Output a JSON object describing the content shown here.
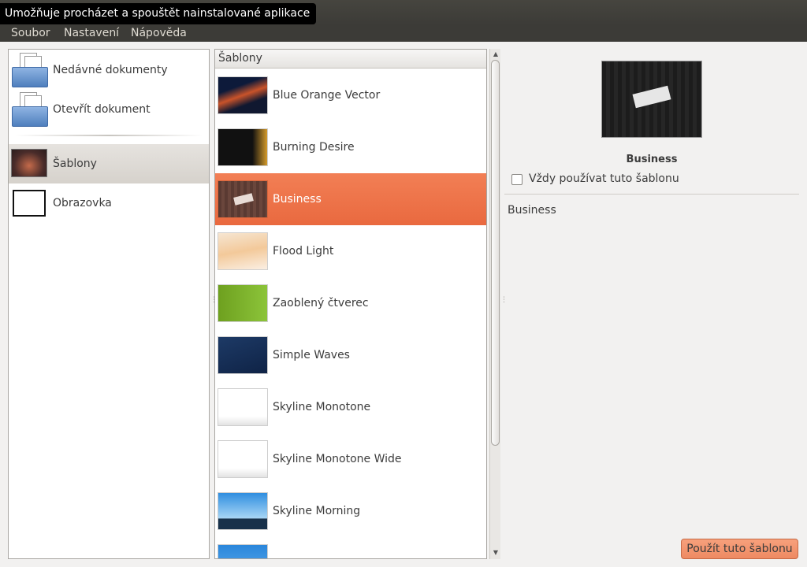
{
  "window": {
    "tooltip": "Umožňuje procházet a spouštět nainstalované aplikace"
  },
  "menubar": {
    "items": [
      "Soubor",
      "Nastavení",
      "Nápověda"
    ]
  },
  "sidebar": {
    "items": [
      {
        "label": "Nedávné dokumenty",
        "icon": "folder-documents-icon"
      },
      {
        "label": "Otevřít dokument",
        "icon": "folder-documents-icon"
      },
      {
        "label": "Šablony",
        "icon": "templates-icon",
        "selected": true
      },
      {
        "label": "Obrazovka",
        "icon": "screen-icon"
      }
    ]
  },
  "templates": {
    "header": "Šablony",
    "items": [
      {
        "label": "Blue Orange Vector",
        "thumb": "blue-orange"
      },
      {
        "label": "Burning Desire",
        "thumb": "burning"
      },
      {
        "label": "Business",
        "thumb": "business",
        "selected": true
      },
      {
        "label": "Flood Light",
        "thumb": "flood"
      },
      {
        "label": "Zaoblený čtverec",
        "thumb": "green"
      },
      {
        "label": "Simple Waves",
        "thumb": "waves"
      },
      {
        "label": "Skyline Monotone",
        "thumb": "skyline"
      },
      {
        "label": "Skyline Monotone Wide",
        "thumb": "skyline"
      },
      {
        "label": "Skyline Morning",
        "thumb": "morning"
      },
      {
        "label": "",
        "thumb": "blue"
      }
    ]
  },
  "preview": {
    "title": "Business",
    "checkbox_label": "Vždy používat tuto šablonu",
    "checkbox_checked": false,
    "description": "Business",
    "apply_label": "Použít tuto šablonu"
  },
  "colors": {
    "accent": "#f07746",
    "titlebar": "#3c3b37"
  }
}
